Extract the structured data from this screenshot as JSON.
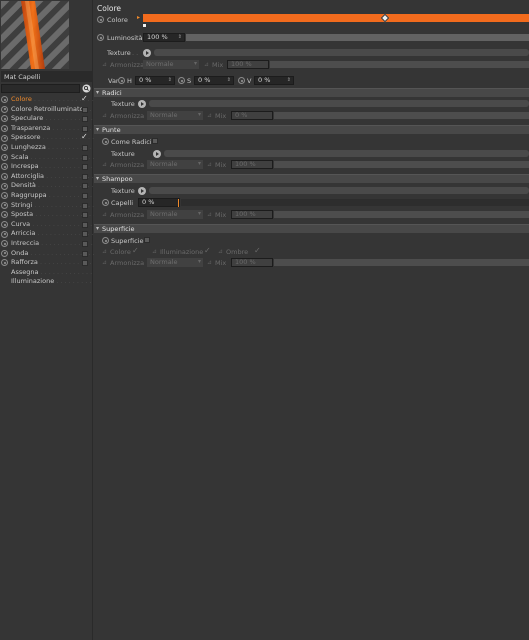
{
  "material": {
    "name": "Mat Capelli",
    "search_value": ""
  },
  "channels": [
    {
      "label": "Colore",
      "active": true,
      "checkbox": "checked",
      "has_radio": true
    },
    {
      "label": "Colore Retroilluminato",
      "active": false,
      "checkbox": "unchecked",
      "has_radio": true
    },
    {
      "label": "Speculare",
      "active": false,
      "checkbox": "unchecked",
      "has_radio": true
    },
    {
      "label": "Trasparenza",
      "active": false,
      "checkbox": "unchecked",
      "has_radio": true
    },
    {
      "label": "Spessore",
      "active": false,
      "checkbox": "checked",
      "has_radio": true
    },
    {
      "label": "Lunghezza",
      "active": false,
      "checkbox": "unchecked",
      "has_radio": true
    },
    {
      "label": "Scala",
      "active": false,
      "checkbox": "unchecked",
      "has_radio": true
    },
    {
      "label": "Increspa",
      "active": false,
      "checkbox": "unchecked",
      "has_radio": true
    },
    {
      "label": "Attorciglia",
      "active": false,
      "checkbox": "unchecked",
      "has_radio": true
    },
    {
      "label": "Densità",
      "active": false,
      "checkbox": "unchecked",
      "has_radio": true
    },
    {
      "label": "Raggruppa",
      "active": false,
      "checkbox": "unchecked",
      "has_radio": true
    },
    {
      "label": "Stringi",
      "active": false,
      "checkbox": "unchecked",
      "has_radio": true
    },
    {
      "label": "Sposta",
      "active": false,
      "checkbox": "unchecked",
      "has_radio": true
    },
    {
      "label": "Curva",
      "active": false,
      "checkbox": "unchecked",
      "has_radio": true
    },
    {
      "label": "Arriccia",
      "active": false,
      "checkbox": "unchecked",
      "has_radio": true
    },
    {
      "label": "Intreccia",
      "active": false,
      "checkbox": "unchecked",
      "has_radio": true
    },
    {
      "label": "Onda",
      "active": false,
      "checkbox": "unchecked",
      "has_radio": true
    },
    {
      "label": "Rafforza",
      "active": false,
      "checkbox": "unchecked",
      "has_radio": true
    },
    {
      "label": "Assegna",
      "active": false,
      "checkbox": "none",
      "has_radio": false
    },
    {
      "label": "Illuminazione",
      "active": false,
      "checkbox": "none",
      "has_radio": false
    }
  ],
  "panel": {
    "title": "Colore",
    "colore_label": "Colore",
    "color_hex": "#f26b1d",
    "luminosita_label": "Luminosità",
    "luminosita_value": "100 %",
    "texture_label": "Texture",
    "armonizza_label": "Armonizza",
    "armonizza_value": "Normale",
    "mix_label": "Mix",
    "mix_value": "100 %",
    "var_label": "Var:",
    "h_label": "H",
    "h_value": "0 %",
    "s_label": "S",
    "s_value": "0 %",
    "v_label": "V",
    "v_value": "0 %"
  },
  "radici": {
    "header": "Radici",
    "texture_label": "Texture",
    "armonizza_label": "Armonizza",
    "armonizza_value": "Normale",
    "mix_label": "Mix",
    "mix_value": "0 %"
  },
  "punte": {
    "header": "Punte",
    "come_radici_label": "Come Radici",
    "texture_label": "Texture",
    "armonizza_label": "Armonizza",
    "armonizza_value": "Normale",
    "mix_label": "Mix",
    "mix_value": "100 %"
  },
  "shampoo": {
    "header": "Shampoo",
    "texture_label": "Texture",
    "capelli_label": "Capelli",
    "capelli_value": "0 %",
    "armonizza_label": "Armonizza",
    "armonizza_value": "Normale",
    "mix_label": "Mix",
    "mix_value": "100 %"
  },
  "superficie": {
    "header": "Superficie",
    "superficie_label": "Superficie",
    "colore_label": "Colore",
    "illuminazione_label": "Illuminazione",
    "ombre_label": "Ombre",
    "armonizza_label": "Armonizza",
    "armonizza_value": "Normale",
    "mix_label": "Mix",
    "mix_value": "100 %"
  },
  "icons": {
    "var_h": "radio-icon",
    "lock": "lock-icon",
    "texture": "texture-play-icon",
    "search": "search-icon"
  }
}
